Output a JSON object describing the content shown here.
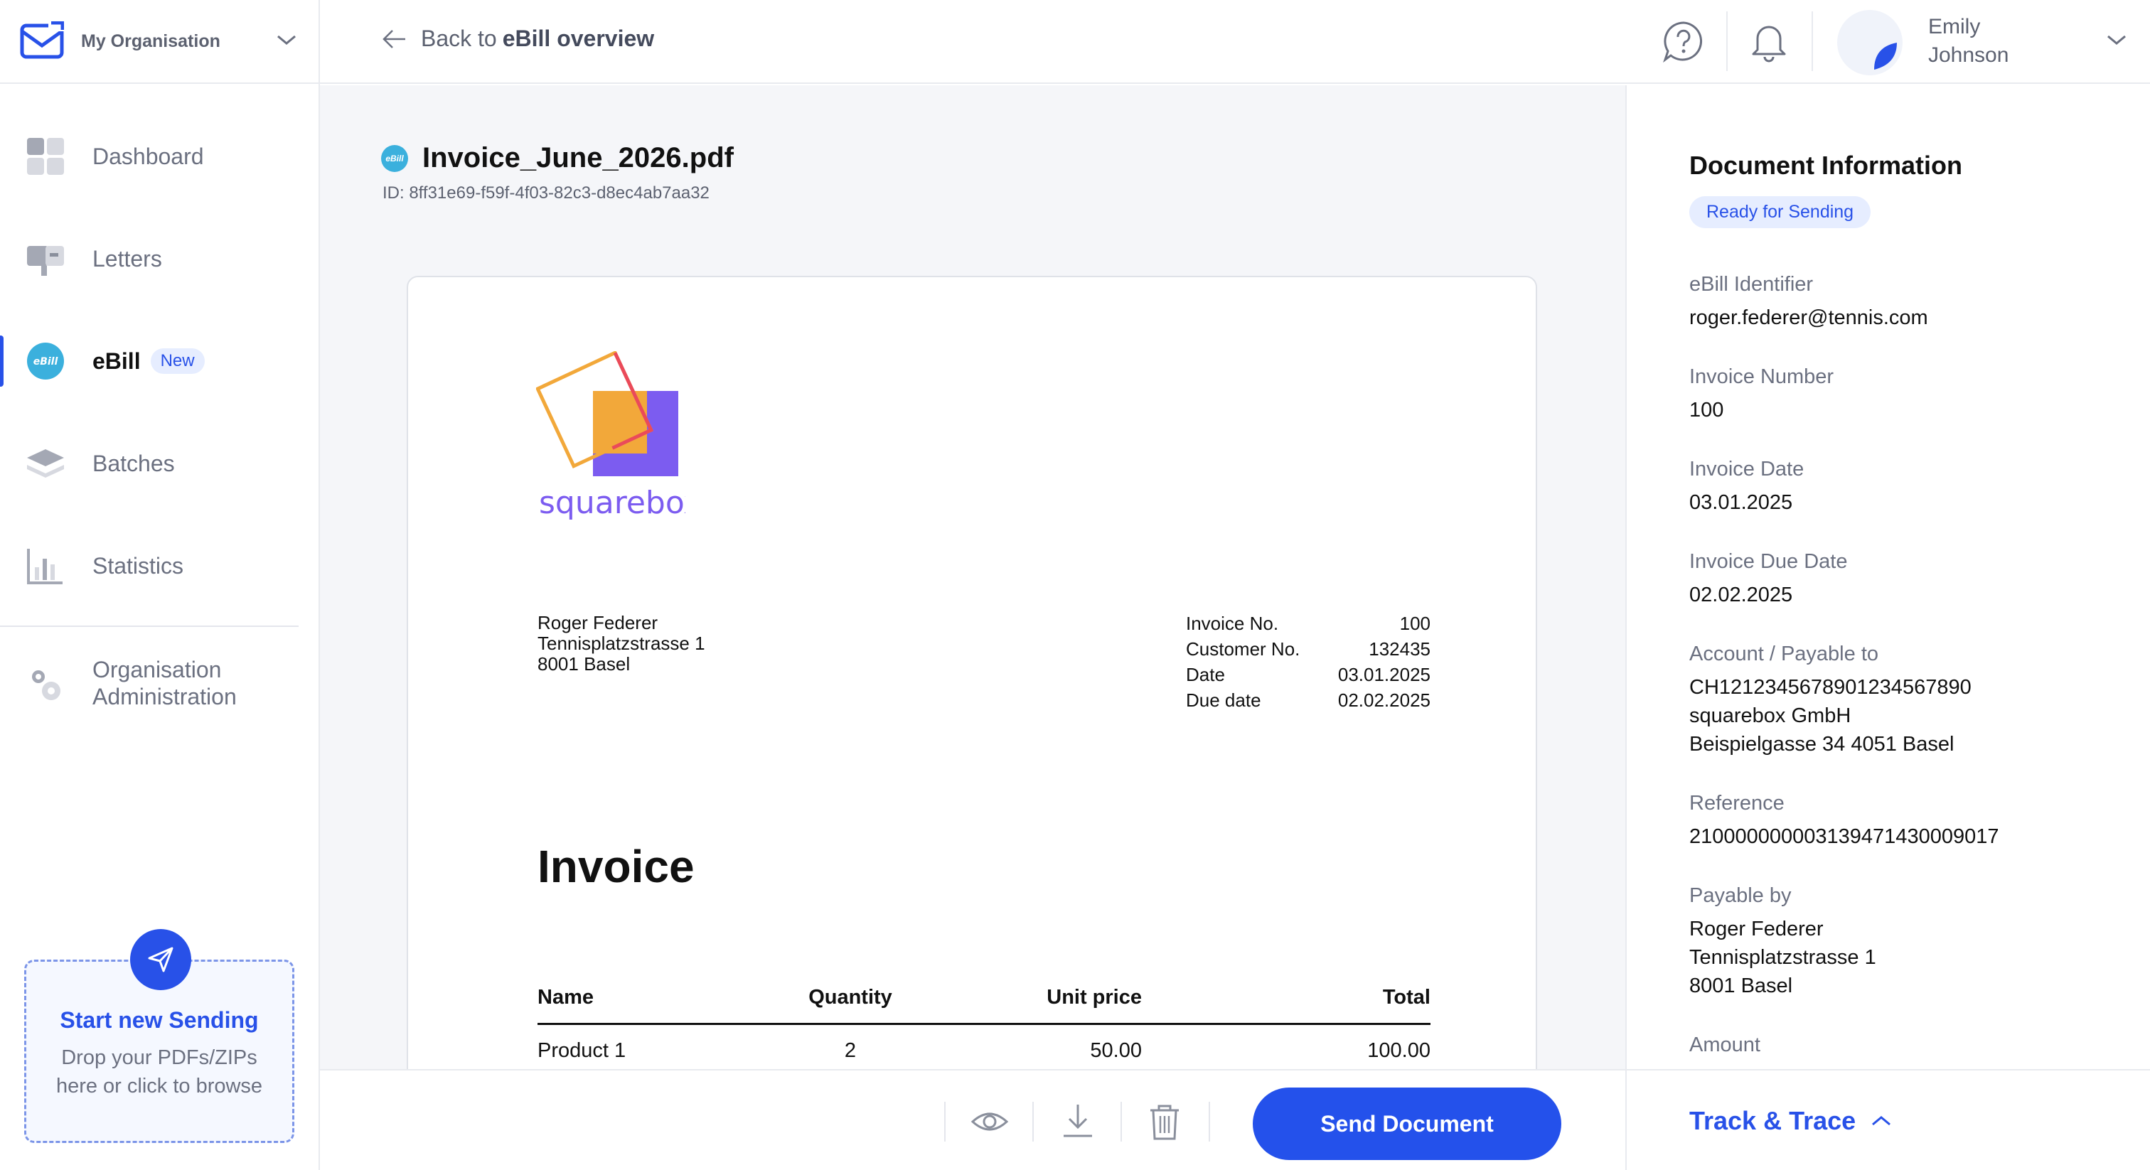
{
  "org": {
    "name": "My Organisation"
  },
  "nav": {
    "items": [
      {
        "label": "Dashboard"
      },
      {
        "label": "Letters"
      },
      {
        "label": "eBill",
        "badge": "New"
      },
      {
        "label": "Batches"
      },
      {
        "label": "Statistics"
      }
    ],
    "admin": {
      "line1": "Organisation",
      "line2": "Administration"
    }
  },
  "dropzone": {
    "title": "Start new Sending",
    "line1": "Drop your PDFs/ZIPs",
    "line2": "here or click to browse"
  },
  "topbar": {
    "back_prefix": "Back to",
    "back_target": "eBill overview",
    "user_first": "Emily",
    "user_last": "Johnson"
  },
  "document": {
    "icon_text": "eBill",
    "filename": "Invoice_June_2026.pdf",
    "id": "ID: 8ff31e69-f59f-4f03-82c3-d8ec4ab7aa32"
  },
  "invoice": {
    "brand": "squarebox",
    "recipient": [
      "Roger Federer",
      "Tennisplatzstrasse 1",
      "8001 Basel"
    ],
    "meta": [
      {
        "label": "Invoice No.",
        "value": "100"
      },
      {
        "label": "Customer No.",
        "value": "132435"
      },
      {
        "label": "Date",
        "value": "03.01.2025"
      },
      {
        "label": "Due date",
        "value": "02.02.2025"
      }
    ],
    "heading": "Invoice",
    "table": {
      "headers": [
        "Name",
        "Quantity",
        "Unit price",
        "Total"
      ],
      "rows": [
        [
          "Product 1",
          "2",
          "50.00",
          "100.00"
        ]
      ]
    }
  },
  "actions": {
    "send_label": "Send Document"
  },
  "info": {
    "title": "Document Information",
    "status": "Ready for Sending",
    "fields": [
      {
        "label": "eBill Identifier",
        "value": [
          "roger.federer@tennis.com"
        ]
      },
      {
        "label": "Invoice Number",
        "value": [
          "100"
        ]
      },
      {
        "label": "Invoice Date",
        "value": [
          "03.01.2025"
        ]
      },
      {
        "label": "Invoice Due Date",
        "value": [
          "02.02.2025"
        ]
      },
      {
        "label": "Account / Payable to",
        "value": [
          "CH1212345678901234567890",
          "squarebox GmbH",
          "Beispielgasse 34 4051 Basel"
        ]
      },
      {
        "label": "Reference",
        "value": [
          "210000000003139471430009017"
        ]
      },
      {
        "label": "Payable by",
        "value": [
          "Roger Federer",
          "Tennisplatzstrasse 1",
          "8001 Basel"
        ]
      },
      {
        "label": "Amount",
        "value": []
      }
    ],
    "track_label": "Track & Trace"
  },
  "colors": {
    "accent": "#2851e8",
    "ebill": "#3bb0dd",
    "background": "#f5f6f9",
    "badge_bg": "#e6edff"
  }
}
